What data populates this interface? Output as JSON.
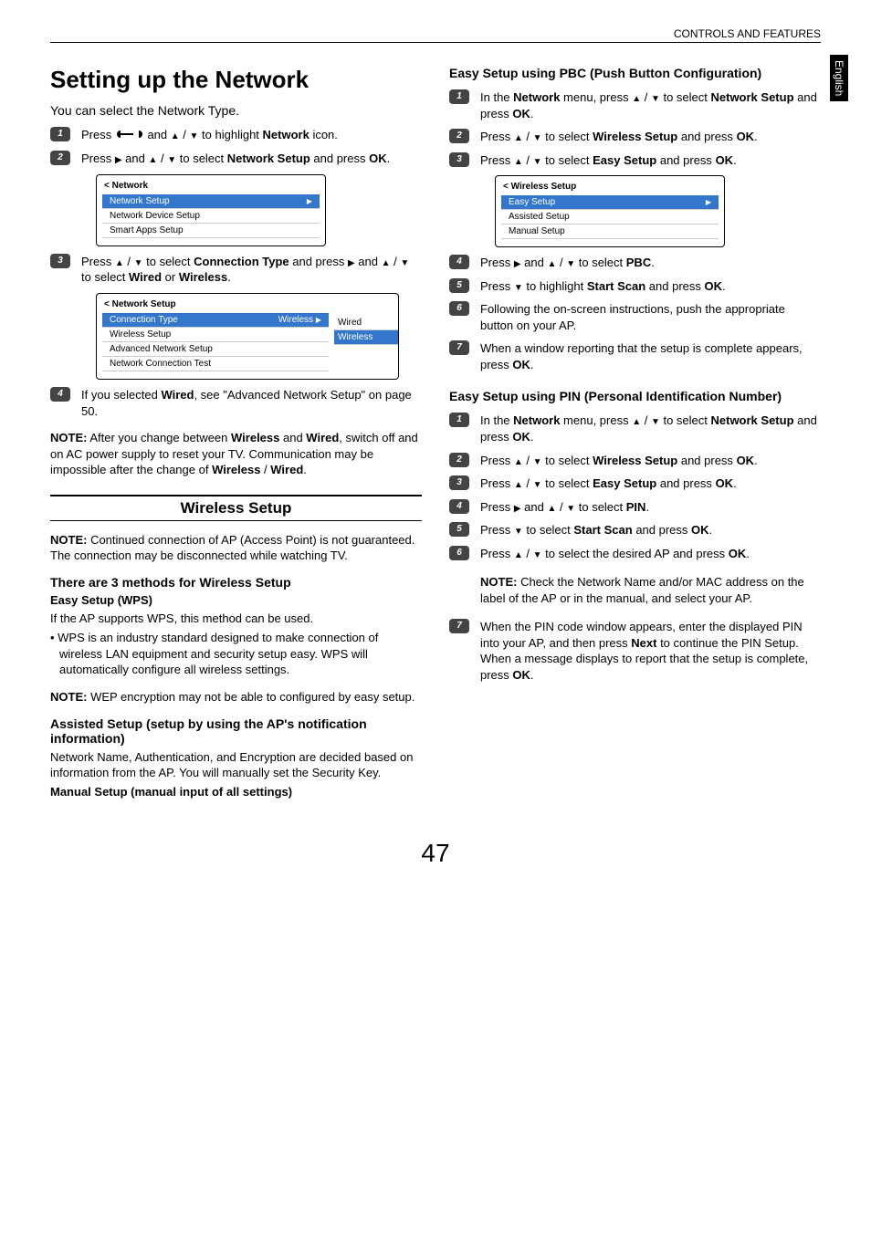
{
  "header": {
    "section": "CONTROLS AND FEATURES",
    "language_tab": "English",
    "page_number": "47"
  },
  "left": {
    "title": "Setting up the Network",
    "intro": "You can select the Network Type.",
    "step1": {
      "prefix": "Press ",
      "mid": " and ",
      "suffix": " to highlight ",
      "target": "Network",
      "end": " icon."
    },
    "step2": {
      "prefix": "Press ",
      "mid": " and ",
      "suffix": " to select ",
      "target": "Network Setup",
      "end": " and press ",
      "ok": "OK",
      "period": "."
    },
    "menu1": {
      "title": "< Network",
      "rows": [
        "Network Setup",
        "Network Device Setup",
        "Smart Apps Setup"
      ],
      "selected": 0
    },
    "step3": {
      "a": "Press ",
      "b": " to select ",
      "t1": "Connection Type",
      "c": " and press ",
      "d": " and ",
      "e": " to select ",
      "t2": "Wired",
      "or": " or ",
      "t3": "Wireless",
      "period": "."
    },
    "menu2": {
      "title": "< Network Setup",
      "rows": [
        "Connection Type",
        "Wireless Setup",
        "Advanced Network Setup",
        "Network Connection Test"
      ],
      "selected": 0,
      "selected_value": "Wireless",
      "options": [
        "Wired",
        "Wireless"
      ],
      "option_selected": 1
    },
    "step4": {
      "a": "If you selected ",
      "t": "Wired",
      "b": ", see \"Advanced Network Setup\" on page 50."
    },
    "note1": {
      "label": "NOTE:",
      "text_a": "  After you change between ",
      "w1": "Wireless",
      "and": " and ",
      "w2": "Wired",
      "text_b": ", switch off and on AC power supply to reset your TV. Communication may be impossible after the change of ",
      "w3": "Wireless",
      "slash": " / ",
      "w4": "Wired",
      "period": "."
    },
    "section_header": "Wireless Setup",
    "note2": {
      "label": "NOTE:",
      "text": " Continued connection of AP (Access Point) is not guaranteed. The connection may be disconnected while watching TV."
    },
    "methods_h": "There are 3 methods for Wireless Setup",
    "easy_h": "Easy Setup (WPS)",
    "easy_p": "If the AP supports WPS, this method can be used.",
    "easy_bullet": "• WPS is an industry standard designed to make connection of wireless LAN equipment and security setup easy. WPS will automatically configure all wireless settings.",
    "note3": {
      "label": "NOTE:",
      "text": "  WEP encryption may not be able to configured by easy setup."
    },
    "assisted_h": "Assisted Setup (setup by using the AP's notification information)",
    "assisted_p": "Network Name, Authentication, and Encryption are decided based on information from the AP. You will manually set the Security Key.",
    "manual_h": "Manual Setup (manual input of all settings)"
  },
  "right": {
    "pbc_h": "Easy Setup using PBC (Push Button Configuration)",
    "s1": {
      "a": "In the ",
      "t1": "Network",
      "b": " menu, press ",
      "c": " to select ",
      "t2": "Network Setup",
      "d": " and press ",
      "ok": "OK",
      "p": "."
    },
    "s2": {
      "a": "Press ",
      "b": " to select ",
      "t": "Wireless Setup",
      "c": " and press ",
      "ok": "OK",
      "p": "."
    },
    "s3": {
      "a": "Press ",
      "b": " to select ",
      "t": "Easy Setup",
      "c": " and press ",
      "ok": "OK",
      "p": "."
    },
    "menu3": {
      "title": "< Wireless Setup",
      "rows": [
        "Easy Setup",
        "Assisted Setup",
        "Manual Setup"
      ],
      "selected": 0
    },
    "s4": {
      "a": "Press ",
      "b": " and ",
      "c": " to select ",
      "t": "PBC",
      "p": "."
    },
    "s5": {
      "a": "Press ",
      "b": " to highlight ",
      "t": "Start Scan",
      "c": " and press ",
      "ok": "OK",
      "p": "."
    },
    "s6": "Following the on-screen instructions, push the appropriate button on your AP.",
    "s7": {
      "a": "When a window reporting that the setup is complete appears, press ",
      "ok": "OK",
      "p": "."
    },
    "pin_h": "Easy Setup using PIN (Personal Identification Number)",
    "p1": {
      "a": "In the ",
      "t1": "Network",
      "b": " menu, press ",
      "c": " to select ",
      "t2": "Network Setup",
      "d": " and press ",
      "ok": "OK",
      "p": "."
    },
    "p2": {
      "a": "Press ",
      "b": " to select ",
      "t": "Wireless Setup",
      "c": " and press ",
      "ok": "OK",
      "p": "."
    },
    "p3": {
      "a": "Press ",
      "b": " to select ",
      "t": "Easy Setup",
      "c": " and press ",
      "ok": "OK",
      "p": "."
    },
    "p4": {
      "a": "Press ",
      "b": " and ",
      "c": " to select ",
      "t": "PIN",
      "p": "."
    },
    "p5": {
      "a": "Press ",
      "b": " to select ",
      "t": "Start Scan",
      "c": " and press ",
      "ok": "OK",
      "p": "."
    },
    "p6": {
      "a": "Press ",
      "b": " to select the desired AP and press ",
      "ok": "OK",
      "p": "."
    },
    "p6note": {
      "label": "NOTE:",
      "text": " Check the Network Name and/or MAC address on the label of the AP or in the manual, and select your AP."
    },
    "p7": {
      "a": "When the PIN code window appears, enter the displayed PIN into your AP, and then press ",
      "t1": "Next",
      "b": " to continue the PIN Setup. When a message displays to report that the setup is complete, press ",
      "ok": "OK",
      "p": "."
    }
  }
}
